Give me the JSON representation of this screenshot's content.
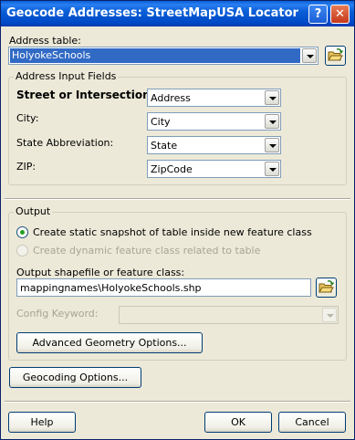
{
  "window": {
    "title": "Geocode Addresses:  StreetMapUSA Locator",
    "help_glyph": "?",
    "close_glyph": "✕"
  },
  "address_table": {
    "label": "Address table:",
    "value": "HolyokeSchools"
  },
  "input_fields": {
    "legend": "Address Input Fields",
    "rows": [
      {
        "label": "Street or Intersection:",
        "value": "Address"
      },
      {
        "label": "City:",
        "value": "City"
      },
      {
        "label": "State Abbreviation:",
        "value": "State"
      },
      {
        "label": "ZIP:",
        "value": "ZipCode"
      }
    ]
  },
  "output": {
    "legend": "Output",
    "option_static": "Create static snapshot of table inside new feature class",
    "option_dynamic": "Create dynamic feature class related to table",
    "shapefile_label": "Output shapefile or feature class:",
    "shapefile_value": "mappingnames\\HolyokeSchools.shp",
    "config_label": "Config Keyword:",
    "config_value": "",
    "advanced_button": "Advanced Geometry Options..."
  },
  "geocoding_button": "Geocoding Options...",
  "footer": {
    "help": "Help",
    "ok": "OK",
    "cancel": "Cancel"
  }
}
